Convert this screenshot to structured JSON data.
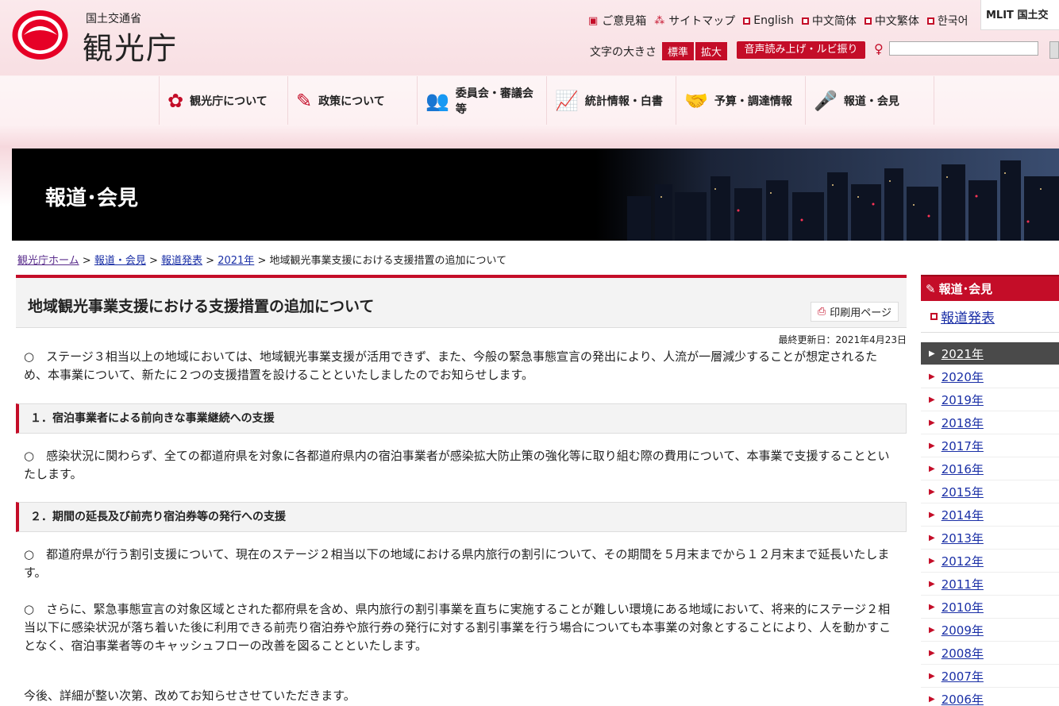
{
  "header": {
    "ministry": "国土交通省",
    "agency": "観光庁",
    "top_links": [
      {
        "icon": "mailbox-icon",
        "label": "ご意見箱"
      },
      {
        "icon": "sitemap-icon",
        "label": "サイトマップ"
      },
      {
        "icon": "square-icon",
        "label": "English"
      },
      {
        "icon": "square-icon",
        "label": "中文简体"
      },
      {
        "icon": "square-icon",
        "label": "中文繁体"
      },
      {
        "icon": "square-icon",
        "label": "한국어"
      }
    ],
    "mlit_logo": "MLIT 国土交",
    "font_size_label": "文字の大きさ",
    "font_standard": "標準",
    "font_large": "拡大",
    "voice_button": "音声読み上げ・ルビ振り",
    "search_value": ""
  },
  "nav": [
    {
      "icon": "flower-icon",
      "label": "観光庁について"
    },
    {
      "icon": "pencil-icon",
      "label": "政策について"
    },
    {
      "icon": "people-icon",
      "label": "委員会・審議会等"
    },
    {
      "icon": "chart-icon",
      "label": "統計情報・白書"
    },
    {
      "icon": "handshake-icon",
      "label": "予算・調達情報"
    },
    {
      "icon": "microphone-icon",
      "label": "報道・会見"
    }
  ],
  "banner": {
    "title": "報道･会見"
  },
  "breadcrumb": {
    "items": [
      "観光庁ホーム",
      "報道・会見",
      "報道発表",
      "2021年"
    ],
    "sep": ">",
    "current": "地域観光事業支援における支援措置の追加について"
  },
  "article": {
    "title": "地域観光事業支援における支援措置の追加について",
    "print_label": "印刷用ページ",
    "updated": "最終更新日：2021年4月23日",
    "intro": "○　ステージ３相当以上の地域においては、地域観光事業支援が活用できず、また、今般の緊急事態宣言の発出により、人流が一層減少することが想定されるため、本事業について、新たに２つの支援措置を設けることといたしましたのでお知らせします。",
    "section1_heading": "１．宿泊事業者による前向きな事業継続への支援",
    "section1_body": "○　感染状況に関わらず、全ての都道府県を対象に各都道府県内の宿泊事業者が感染拡大防止策の強化等に取り組む際の費用について、本事業で支援することといたします。",
    "section2_heading": "２．期間の延長及び前売り宿泊券等の発行への支援",
    "section2_body1": "○　都道府県が行う割引支援について、現在のステージ２相当以下の地域における県内旅行の割引について、その期間を５月末までから１２月末まで延長いたします。",
    "section2_body2": "○　さらに、緊急事態宣言の対象区域とされた都府県を含め、県内旅行の割引事業を直ちに実施することが難しい環境にある地域において、将来的にステージ２相当以下に感染状況が落ち着いた後に利用できる前売り宿泊券や旅行券の発行に対する割引事業を行う場合についても本事業の対象とすることにより、人を動かすことなく、宿泊事業者等のキャッシュフローの改善を図ることといたします。",
    "closing": "今後、詳細が整い次第、改めてお知らせさせていただきます。"
  },
  "sidebar": {
    "heading": "報道･会見",
    "sub": "報道発表",
    "years": [
      "2021年",
      "2020年",
      "2019年",
      "2018年",
      "2017年",
      "2016年",
      "2015年",
      "2014年",
      "2013年",
      "2012年",
      "2011年",
      "2010年",
      "2009年",
      "2008年",
      "2007年",
      "2006年"
    ],
    "active_year": "2021年"
  },
  "colors": {
    "accent": "#c40d28",
    "active_bg": "#4a4a4a"
  }
}
